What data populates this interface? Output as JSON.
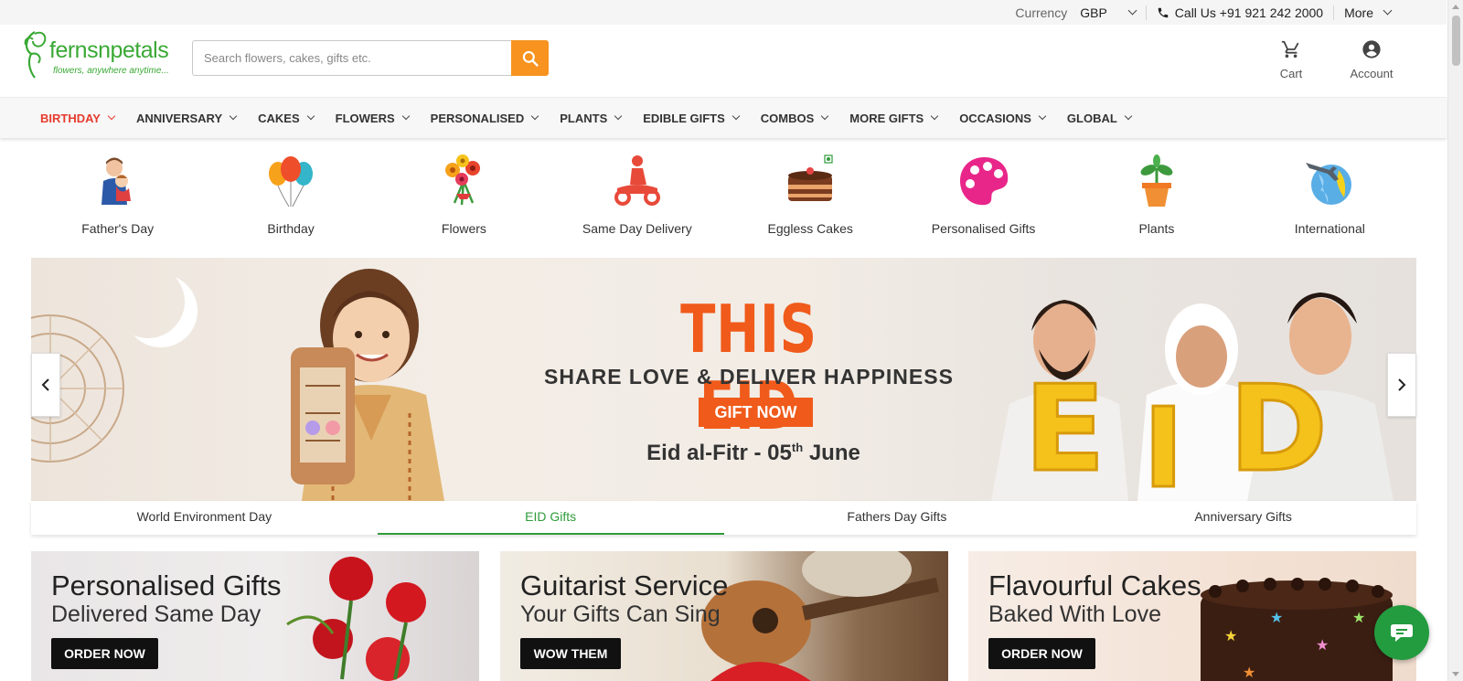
{
  "topbar": {
    "currency_label": "Currency",
    "currency_value": "GBP",
    "call_label": "Call Us +91 921 242 2000",
    "more_label": "More"
  },
  "brand": {
    "name": "fernsnpetals",
    "tagline": "flowers, anywhere anytime...",
    "accent": "#3aa935"
  },
  "search": {
    "placeholder": "Search flowers, cakes, gifts etc."
  },
  "header_actions": {
    "cart_label": "Cart",
    "account_label": "Account"
  },
  "nav": [
    {
      "label": "BIRTHDAY"
    },
    {
      "label": "ANNIVERSARY"
    },
    {
      "label": "CAKES"
    },
    {
      "label": "FLOWERS"
    },
    {
      "label": "PERSONALISED"
    },
    {
      "label": "PLANTS"
    },
    {
      "label": "EDIBLE GIFTS"
    },
    {
      "label": "COMBOS"
    },
    {
      "label": "MORE GIFTS"
    },
    {
      "label": "OCCASIONS"
    },
    {
      "label": "GLOBAL"
    }
  ],
  "categories": [
    {
      "label": "Father's Day",
      "icon": "fathers-day-icon"
    },
    {
      "label": "Birthday",
      "icon": "balloons-icon"
    },
    {
      "label": "Flowers",
      "icon": "flower-bouquet-icon"
    },
    {
      "label": "Same Day Delivery",
      "icon": "delivery-scooter-icon"
    },
    {
      "label": "Eggless Cakes",
      "icon": "cake-icon"
    },
    {
      "label": "Personalised Gifts",
      "icon": "palette-icon"
    },
    {
      "label": "Plants",
      "icon": "potted-plant-icon"
    },
    {
      "label": "International",
      "icon": "globe-plane-icon"
    }
  ],
  "banner": {
    "headline": "THIS EID",
    "subheadline": "SHARE LOVE & DELIVER HAPPINESS",
    "cta": "GIFT NOW",
    "date_prefix": "Eid al-Fitr - 05",
    "date_suffix_sup": "th",
    "date_month": "June",
    "balloon_letters": [
      "E",
      "I",
      "D"
    ],
    "accent": "#f05a1a"
  },
  "slider_tabs": [
    {
      "label": "World Environment Day"
    },
    {
      "label": "EID Gifts"
    },
    {
      "label": "Fathers Day Gifts"
    },
    {
      "label": "Anniversary Gifts"
    }
  ],
  "promos": [
    {
      "title": "Personalised Gifts",
      "subtitle": "Delivered Same Day",
      "button": "ORDER NOW"
    },
    {
      "title": "Guitarist Service",
      "subtitle": "Your Gifts Can Sing",
      "button": "WOW THEM"
    },
    {
      "title": "Flavourful Cakes",
      "subtitle": "Baked With Love",
      "button": "ORDER NOW"
    }
  ],
  "colors": {
    "active_nav": "#e63b2e",
    "active_tab": "#2f9c3a",
    "search_button": "#f7931e",
    "chat": "#239b3f"
  }
}
